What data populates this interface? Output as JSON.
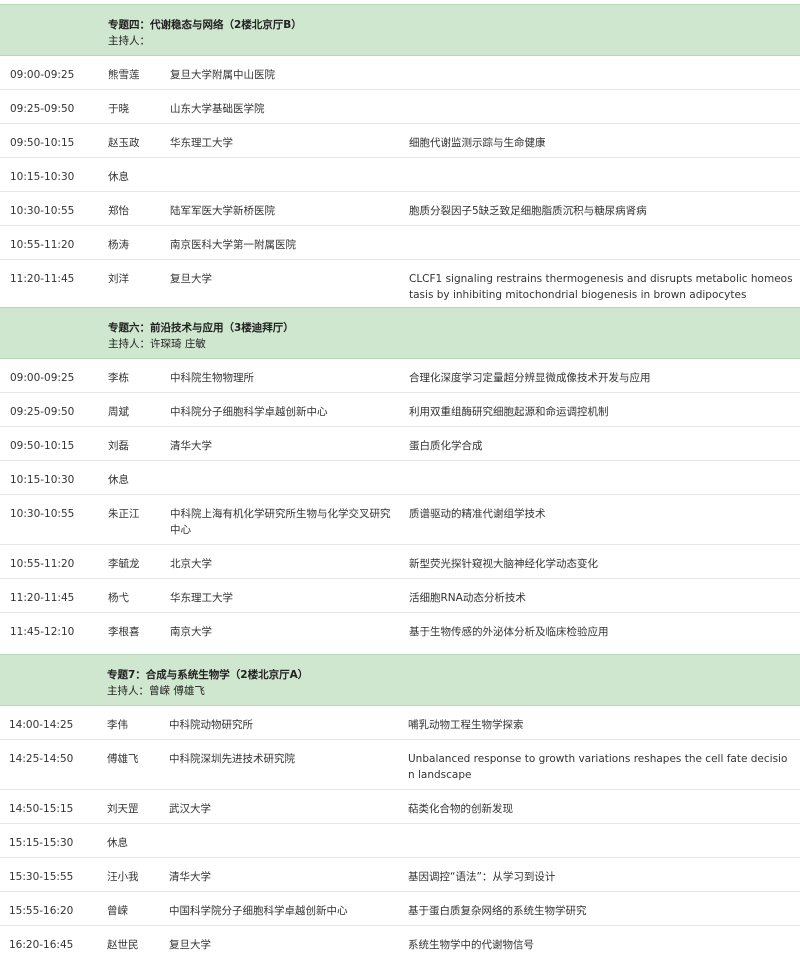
{
  "sections": [
    {
      "title": "专题四：代谢稳态与网络（2楼北京厅B）",
      "host": "主持人：",
      "rows": [
        {
          "time": "09:00-09:25",
          "speaker": "熊雪莲",
          "org": "复旦大学附属中山医院",
          "topic": ""
        },
        {
          "time": "09:25-09:50",
          "speaker": "于晓",
          "org": "山东大学基础医学院",
          "topic": ""
        },
        {
          "time": "09:50-10:15",
          "speaker": "赵玉政",
          "org": "华东理工大学",
          "topic": "细胞代谢监测示踪与生命健康"
        },
        {
          "time": "10:15-10:30",
          "speaker": "休息",
          "org": "",
          "topic": ""
        },
        {
          "time": "10:30-10:55",
          "speaker": "郑怡",
          "org": "陆军军医大学新桥医院",
          "topic": "胞质分裂因子5缺乏致足细胞脂质沉积与糖尿病肾病"
        },
        {
          "time": "10:55-11:20",
          "speaker": "杨涛",
          "org": "南京医科大学第一附属医院",
          "topic": ""
        },
        {
          "time": "11:20-11:45",
          "speaker": "刘洋",
          "org": "复旦大学",
          "topic": "CLCF1 signaling restrains thermogenesis and disrupts metabolic homeostasis by inhibiting mitochondrial biogenesis in brown adipocytes"
        }
      ]
    },
    {
      "title": "专题六：前沿技术与应用（3楼迪拜厅）",
      "host": "主持人：许琛琦 庄敏",
      "rows": [
        {
          "time": "09:00-09:25",
          "speaker": "李栋",
          "org": "中科院生物物理所",
          "topic": "合理化深度学习定量超分辨显微成像技术开发与应用"
        },
        {
          "time": "09:25-09:50",
          "speaker": "周斌",
          "org": "中科院分子细胞科学卓越创新中心",
          "topic": "利用双重组酶研究细胞起源和命运调控机制"
        },
        {
          "time": "09:50-10:15",
          "speaker": "刘磊",
          "org": "清华大学",
          "topic": "蛋白质化学合成"
        },
        {
          "time": "10:15-10:30",
          "speaker": "休息",
          "org": "",
          "topic": ""
        },
        {
          "time": "10:30-10:55",
          "speaker": "朱正江",
          "org": "中科院上海有机化学研究所生物与化学交叉研究中心",
          "topic": "质谱驱动的精准代谢组学技术"
        },
        {
          "time": "10:55-11:20",
          "speaker": "李毓龙",
          "org": "北京大学",
          "topic": "新型荧光探针窥视大脑神经化学动态变化"
        },
        {
          "time": "11:20-11:45",
          "speaker": "杨弋",
          "org": "华东理工大学",
          "topic": "活细胞RNA动态分析技术"
        },
        {
          "time": "11:45-12:10",
          "speaker": "李根喜",
          "org": "南京大学",
          "topic": "基于生物传感的外泌体分析及临床检验应用"
        }
      ]
    },
    {
      "title": "专题7：合成与系统生物学（2楼北京厅A）",
      "host": "主持人：曾嵘 傅雄飞",
      "rows": [
        {
          "time": "14:00-14:25",
          "speaker": "李伟",
          "org": "中科院动物研究所",
          "topic": "哺乳动物工程生物学探索"
        },
        {
          "time": "14:25-14:50",
          "speaker": "傅雄飞",
          "org": "中科院深圳先进技术研究院",
          "topic": "Unbalanced response to growth variations reshapes the cell fate decision landscape"
        },
        {
          "time": "14:50-15:15",
          "speaker": "刘天罡",
          "org": "武汉大学",
          "topic": "萜类化合物的创新发现"
        },
        {
          "time": "15:15-15:30",
          "speaker": "休息",
          "org": "",
          "topic": ""
        },
        {
          "time": "15:30-15:55",
          "speaker": "汪小我",
          "org": "清华大学",
          "topic": "基因调控“语法”：从学习到设计"
        },
        {
          "time": "15:55-16:20",
          "speaker": "曾嵘",
          "org": "中国科学院分子细胞科学卓越创新中心",
          "topic": "基于蛋白质复杂网络的系统生物学研究"
        },
        {
          "time": "16:20-16:45",
          "speaker": "赵世民",
          "org": "复旦大学",
          "topic": "系统生物学中的代谢物信号"
        }
      ]
    }
  ]
}
